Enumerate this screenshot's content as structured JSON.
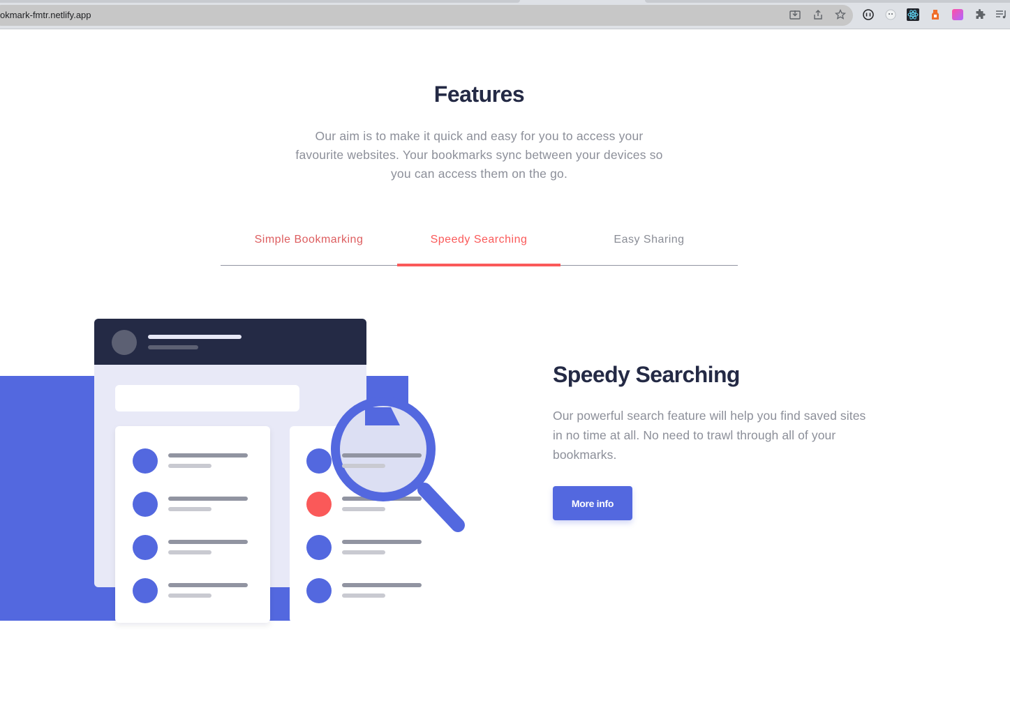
{
  "browser": {
    "url": "okmark-fmtr.netlify.app",
    "icons": [
      "install-icon",
      "share-icon",
      "bookmark-star-icon",
      "extension-1-icon",
      "extension-2-icon",
      "react-devtools-icon",
      "extension-3-icon",
      "extension-4-icon",
      "extensions-puzzle-icon",
      "media-playlist-icon"
    ]
  },
  "features": {
    "title": "Features",
    "description": "Our aim is to make it quick and easy for you to access your favourite websites. Your bookmarks sync between your devices so you can access them on the go."
  },
  "tabs": [
    {
      "label": "Simple Bookmarking",
      "active": false
    },
    {
      "label": "Speedy Searching",
      "active": true
    },
    {
      "label": "Easy Sharing",
      "active": false
    }
  ],
  "panel": {
    "title": "Speedy Searching",
    "description": "Our powerful search feature will help you find saved sites in no time at all. No need to trawl through all of your bookmarks.",
    "button_label": "More info"
  },
  "colors": {
    "primary_blue": "#5368df",
    "soft_red": "#fa5959",
    "very_dark_blue": "#242a45",
    "grayish_blue": "#8c8f99"
  }
}
